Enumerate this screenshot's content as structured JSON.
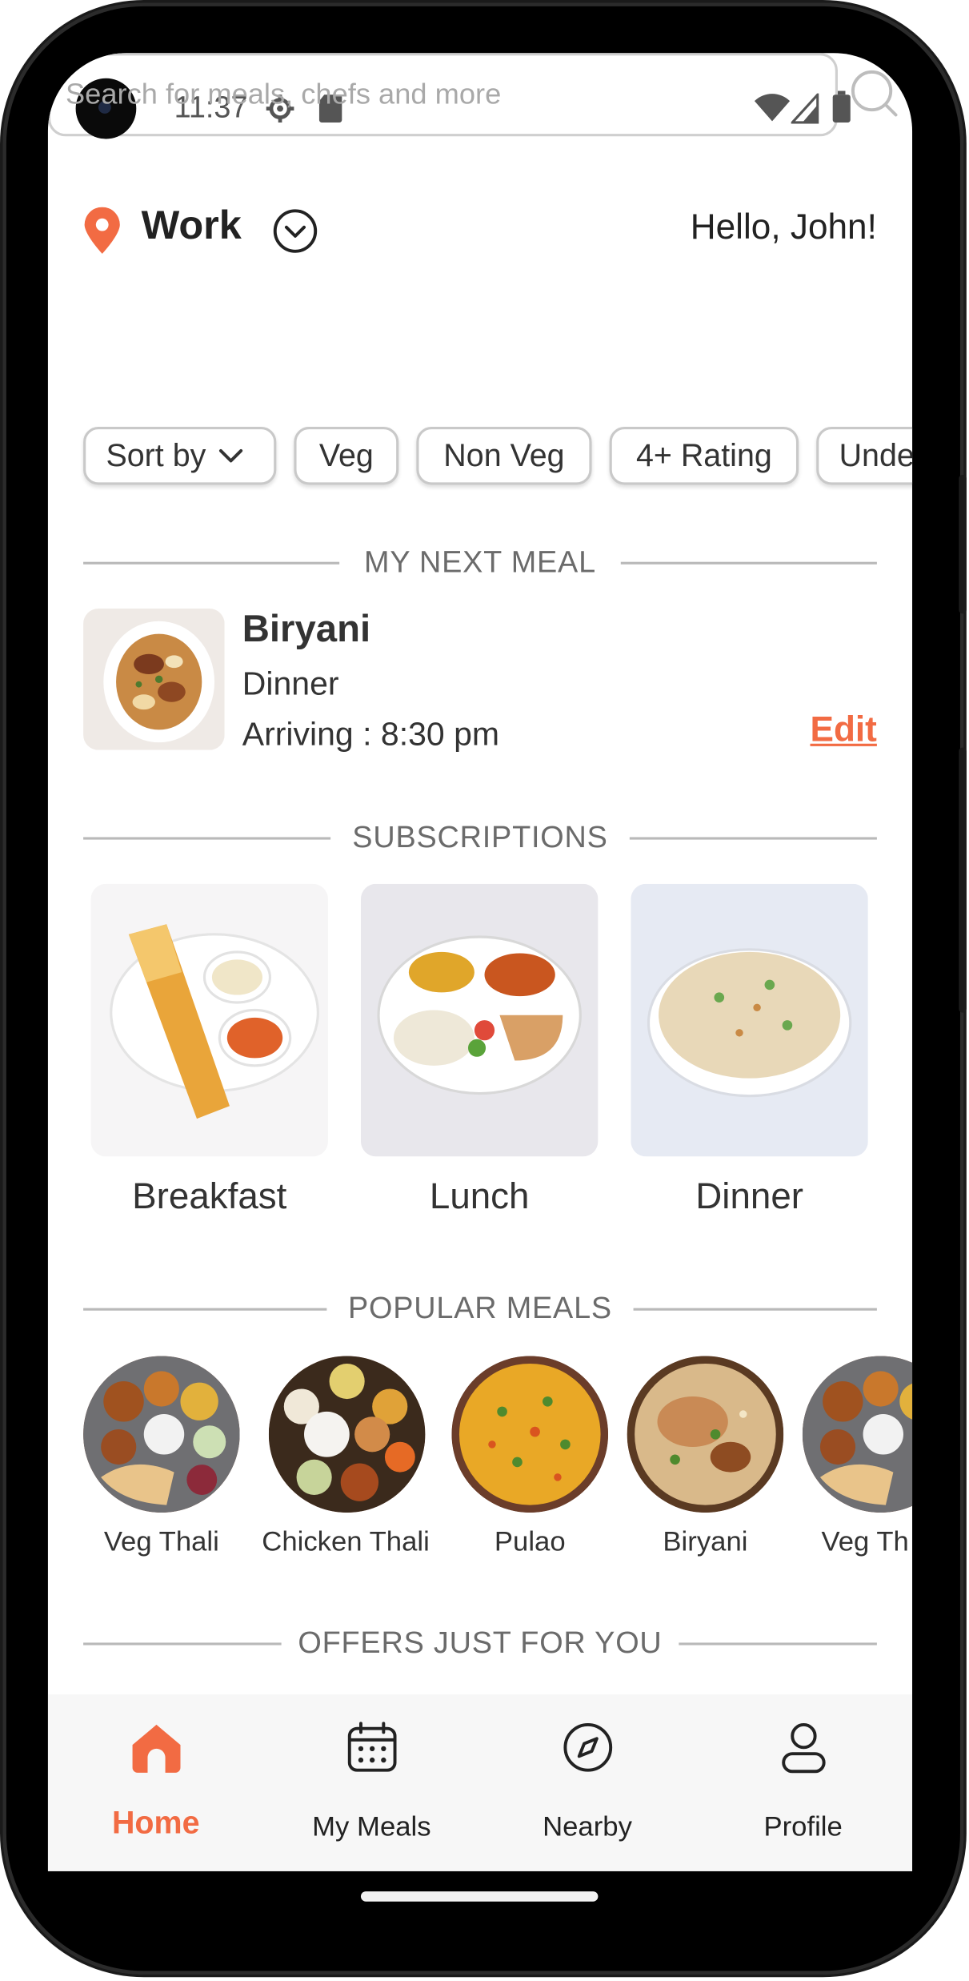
{
  "status_bar": {
    "time": "11:37"
  },
  "header": {
    "location": "Work",
    "greeting": "Hello, John!"
  },
  "search": {
    "placeholder": "Search for meals, chefs and more"
  },
  "filters": [
    "Sort by",
    "Veg",
    "Non Veg",
    "4+ Rating",
    "Unde"
  ],
  "next_meal": {
    "section_title": "MY NEXT MEAL",
    "name": "Biryani",
    "meal_type": "Dinner",
    "arriving": "Arriving : 8:30 pm",
    "edit_label": "Edit"
  },
  "subscriptions": {
    "section_title": "SUBSCRIPTIONS",
    "items": [
      "Breakfast",
      "Lunch",
      "Dinner"
    ]
  },
  "popular": {
    "section_title": "POPULAR MEALS",
    "items": [
      "Veg Thali",
      "Chicken Thali",
      "Pulao",
      "Biryani",
      "Veg Th"
    ]
  },
  "offers": {
    "section_title": "OFFERS JUST FOR YOU"
  },
  "nav": {
    "items": [
      "Home",
      "My Meals",
      "Nearby",
      "Profile"
    ],
    "active": "Home"
  },
  "colors": {
    "accent": "#f26b43",
    "text": "#222222",
    "muted": "#6b6b6b"
  }
}
